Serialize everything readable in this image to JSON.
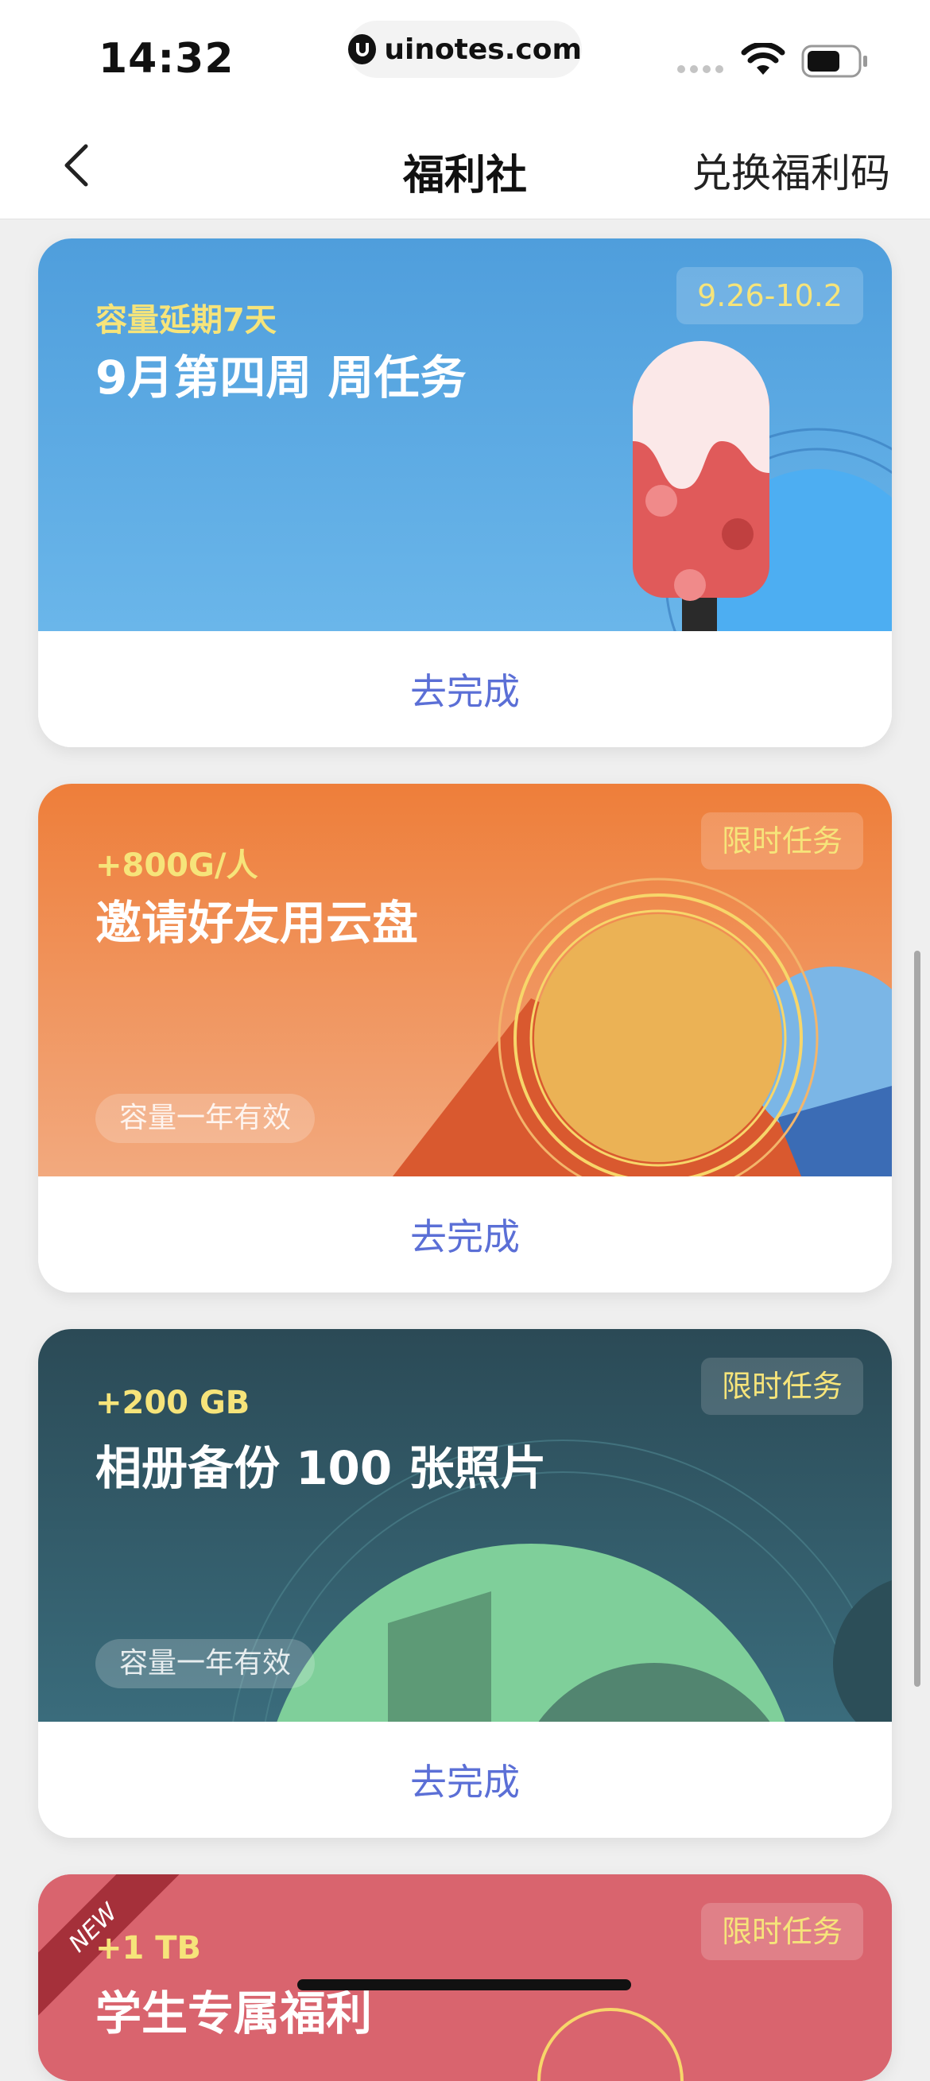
{
  "status_bar": {
    "time": "14:32",
    "url": "uinotes.com"
  },
  "nav": {
    "title": "福利社",
    "action": "兑换福利码"
  },
  "cards": [
    {
      "bonus": "容量延期7天",
      "title": "9月第四周 周任务",
      "tag": "9.26-10.2",
      "validity": "",
      "action": "去完成",
      "theme": "#5aa6e0",
      "illustration": "popsicle-icon"
    },
    {
      "bonus": "+800G/人",
      "title": "邀请好友用云盘",
      "tag": "限时任务",
      "validity": "容量一年有效",
      "action": "去完成",
      "theme": "#ef8a4a",
      "illustration": "coin-icon"
    },
    {
      "bonus": "+200 GB",
      "title": "相册备份 100 张照片",
      "tag": "限时任务",
      "validity": "容量一年有效",
      "action": "去完成",
      "theme": "#2f5664",
      "illustration": "number-100-icon"
    },
    {
      "bonus": "+1 TB",
      "title": "学生专属福利",
      "tag": "限时任务",
      "ribbon": "NEW",
      "theme": "#d9646e"
    }
  ]
}
